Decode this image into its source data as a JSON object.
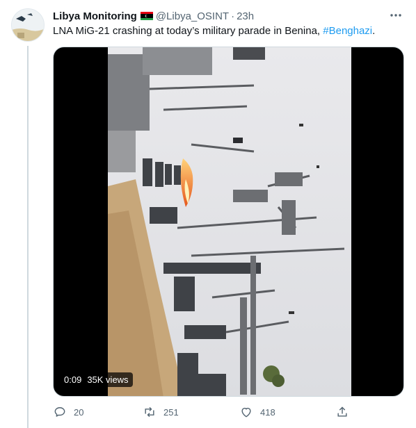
{
  "tweet": {
    "author": {
      "name": "Libya Monitoring",
      "handle": "@Libya_OSINT",
      "avatar_icon": "avatar-image",
      "flag_icon": "libya-flag-icon"
    },
    "separator": "·",
    "time": "23h",
    "text_before": "LNA MiG-21 crashing at today’s military parade in Benina, ",
    "hashtag": "#Benghazi",
    "text_after": ".",
    "video": {
      "duration": "0:09",
      "views": "35K views"
    },
    "actions": {
      "reply_count": "20",
      "retweet_count": "251",
      "like_count": "418"
    }
  },
  "colors": {
    "link": "#1d9bf0",
    "secondary_text": "#536471",
    "thread_line": "#cfd9de"
  }
}
